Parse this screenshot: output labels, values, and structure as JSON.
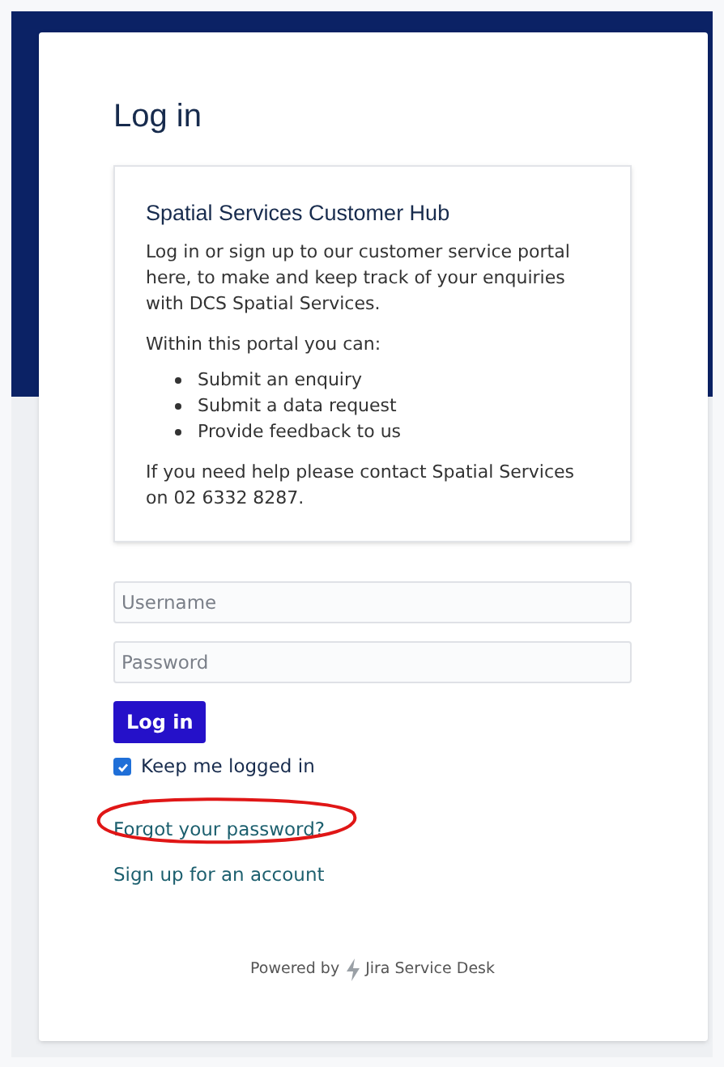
{
  "title": "Log in",
  "info": {
    "heading": "Spatial Services Customer Hub",
    "intro": "Log in or sign up to our customer service portal here, to make and keep track of your enquiries with DCS Spatial Services.",
    "list_intro": "Within this portal you can:",
    "items": [
      "Submit an enquiry",
      "Submit a data request",
      "Provide feedback to us"
    ],
    "contact": "If you need help please contact Spatial Services on 02 6332 8287."
  },
  "fields": [
    {
      "placeholder": "Username"
    },
    {
      "placeholder": "Password"
    }
  ],
  "login_button": "Log in",
  "keep_logged_in": {
    "label": "Keep me logged in",
    "checked": true
  },
  "links": [
    "Forgot your password?",
    "Sign up for an account"
  ],
  "footer": {
    "prefix": "Powered by",
    "product": "Jira Service Desk"
  }
}
